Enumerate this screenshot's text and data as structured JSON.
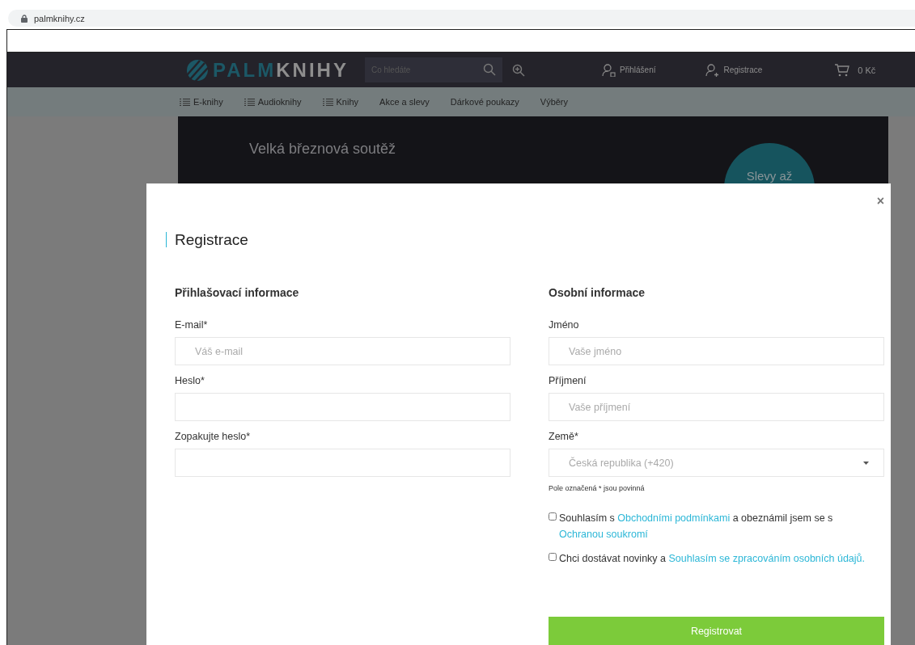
{
  "browser": {
    "url": "palmknihy.cz"
  },
  "header": {
    "logo": {
      "part_1": "PALM",
      "part_2": "KNIHY"
    },
    "search": {
      "placeholder": "Co hledáte"
    },
    "login": "Přihlášení",
    "register": "Registrace",
    "cart": "0 Kč"
  },
  "nav": [
    {
      "label": "E-knihy",
      "kind": "menu"
    },
    {
      "label": "Audioknihy",
      "kind": "menu"
    },
    {
      "label": "Knihy",
      "kind": "menu"
    },
    {
      "label": "Akce a slevy",
      "kind": "link"
    },
    {
      "label": "Dárkové poukazy",
      "kind": "link"
    },
    {
      "label": "Výběry",
      "kind": "link"
    }
  ],
  "banner": {
    "subtitle": "Velká březnová soutěž",
    "badge": "Slevy až"
  },
  "modal": {
    "close": "×",
    "title": "Registrace",
    "columns": [
      {
        "heading": "Přihlašovací informace",
        "fields": [
          {
            "label": "E-mail*",
            "kind": "text",
            "placeholder": "Váš e-mail"
          },
          {
            "label": "Heslo*",
            "kind": "text"
          },
          {
            "label": "Zopakujte heslo*",
            "kind": "text"
          }
        ]
      },
      {
        "heading": "Osobní informace",
        "fields": [
          {
            "label": "Jméno",
            "kind": "text",
            "placeholder": "Vaše jméno"
          },
          {
            "label": "Příjmení",
            "kind": "text",
            "placeholder": "Vaše příjmení"
          },
          {
            "label": "Země*",
            "kind": "select",
            "value": "Česká republika (+420)"
          }
        ],
        "note": "Pole označená * jsou povinná",
        "consents": [
          {
            "checked": false,
            "parts": [
              {
                "text": "Souhlasím s ",
                "kind": "text"
              },
              {
                "text": "Obchodními podmínkami",
                "kind": "link"
              },
              {
                "text": " a obeznámil jsem se s ",
                "kind": "text"
              },
              {
                "text": "Ochranou soukromí",
                "kind": "link"
              }
            ]
          },
          {
            "checked": false,
            "parts": [
              {
                "text": "Chci dostávat novinky a ",
                "kind": "text"
              },
              {
                "text": "Souhlasím se zpracováním osobních údajů.",
                "kind": "link"
              }
            ]
          }
        ],
        "submit": "Registrovat"
      }
    ]
  }
}
